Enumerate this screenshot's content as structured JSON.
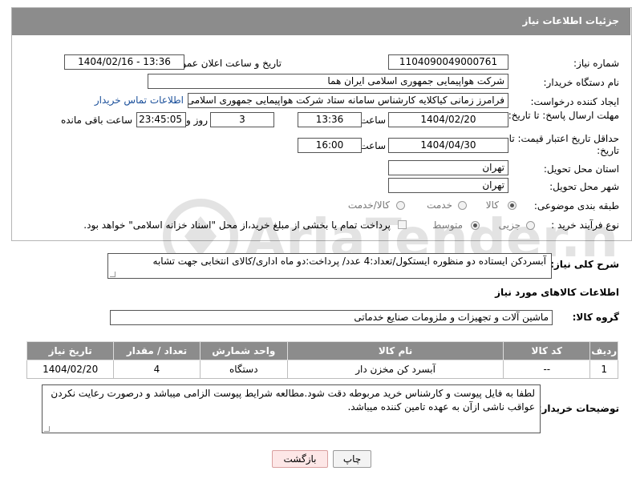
{
  "header": {
    "title": "جزئیات اطلاعات نیاز"
  },
  "fields": {
    "need_number_label": "شماره نیاز:",
    "need_number": "1104090049000761",
    "announce_label": "تاریخ و ساعت اعلان عمومی:",
    "announce_value": "1404/02/16 - 13:36",
    "buyer_org_label": "نام دستگاه خریدار:",
    "buyer_org": "شرکت هواپیمایی جمهوری اسلامی ایران هما",
    "creator_label": "ایجاد کننده درخواست:",
    "creator": "فرامرز زمانی کیاکلایه کارشناس سامانه ستاد شرکت هواپیمایی جمهوری اسلامی ایران هما",
    "contact_link": "اطلاعات تماس خریدار",
    "deadline_label": "مهلت ارسال پاسخ: تا تاریخ:",
    "deadline_date": "1404/02/20",
    "time_label": "ساعت",
    "deadline_time": "13:36",
    "days_value": "3",
    "days_label": "روز و",
    "remaining_time": "23:45:05",
    "remaining_label": "ساعت باقی مانده",
    "price_valid_label": "حداقل تاریخ اعتبار قیمت: تا تاریخ:",
    "price_valid_date": "1404/04/30",
    "price_valid_time": "16:00",
    "province_label": "استان محل تحویل:",
    "province": "تهران",
    "city_label": "شهر محل تحویل:",
    "city": "تهران",
    "category_label": "طبقه بندی موضوعی:",
    "category_options": [
      "کالا",
      "خدمت",
      "کالا/خدمت"
    ],
    "category_selected": "کالا",
    "process_label": "نوع فرآیند خرید :",
    "process_options": [
      "جزیی",
      "متوسط"
    ],
    "process_selected": "متوسط",
    "payment_text": "پرداخت تمام یا بخشی از مبلغ خرید،از محل \"اسناد خزانه اسلامی\" خواهد بود."
  },
  "description": {
    "label": "شرح کلی نیاز:",
    "text": "آبسردکن ایستاده دو منظوره ایستکول/تعداد:4 عدد/ پرداخت:دو ماه اداری/کالای انتخابی جهت تشابه"
  },
  "goods_section": {
    "title": "اطلاعات کالاهای مورد نیاز",
    "group_label": "گروه کالا:",
    "group_value": "ماشین آلات و تجهیزات و ملزومات صنایع خدماتی"
  },
  "table": {
    "headers": [
      "ردیف",
      "کد کالا",
      "نام کالا",
      "واحد شمارش",
      "تعداد / مقدار",
      "تاریخ نیاز"
    ],
    "rows": [
      [
        "1",
        "--",
        "آبسرد کن مخزن دار",
        "دستگاه",
        "4",
        "1404/02/20"
      ]
    ]
  },
  "buyer_notes": {
    "label": "توضیحات خریدار:",
    "text": "لطفا به فایل پیوست و کارشناس خرید مربوطه دقت شود.مطالعه شرایط پیوست الزامی میباشد و درصورت رعایت نکردن عواقب ناشی ازآن به عهده تامین کننده میباشد."
  },
  "buttons": {
    "print": "چاپ",
    "back": "بازگشت"
  },
  "watermark_text": "AriaTender.neT",
  "colors": {
    "header_bg": "#8c8c8c",
    "link": "#1a4f9a",
    "back_button_bg": "#fde7e7"
  }
}
